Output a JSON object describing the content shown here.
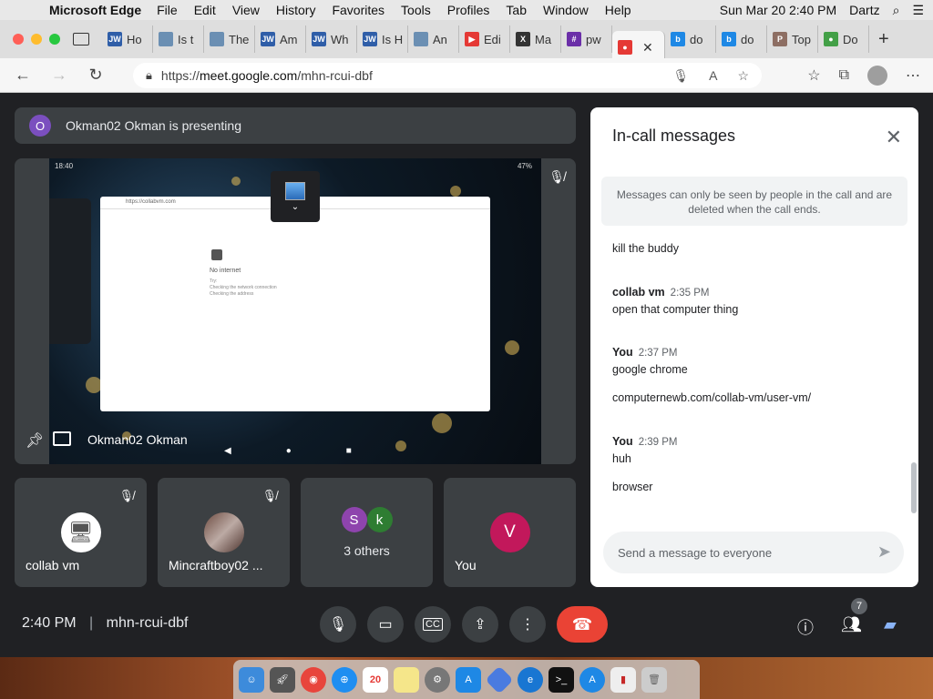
{
  "menubar": {
    "app_name": "Microsoft Edge",
    "items": [
      "File",
      "Edit",
      "View",
      "History",
      "Favorites",
      "Tools",
      "Profiles",
      "Tab",
      "Window",
      "Help"
    ],
    "datetime": "Sun Mar 20  2:40 PM",
    "user": "Dartz"
  },
  "tabs": [
    {
      "label": "Ho",
      "fav": "JW",
      "color": "#2f5ea8"
    },
    {
      "label": "Is t",
      "fav": "",
      "color": "#6b8fb3"
    },
    {
      "label": "The",
      "fav": "",
      "color": "#6b8fb3"
    },
    {
      "label": "Am",
      "fav": "JW",
      "color": "#2f5ea8"
    },
    {
      "label": "Wh",
      "fav": "JW",
      "color": "#2f5ea8"
    },
    {
      "label": "Is H",
      "fav": "JW",
      "color": "#2f5ea8"
    },
    {
      "label": "An",
      "fav": "",
      "color": "#6b8fb3"
    },
    {
      "label": "Edi",
      "fav": "▶",
      "color": "#e53935"
    },
    {
      "label": "Ma",
      "fav": "X",
      "color": "#333"
    },
    {
      "label": "pw",
      "fav": "#",
      "color": "#6b2fa8"
    },
    {
      "label": "",
      "fav": "●",
      "color": "#e53935",
      "active": true
    },
    {
      "label": "do",
      "fav": "b",
      "color": "#1e88e5"
    },
    {
      "label": "do",
      "fav": "b",
      "color": "#1e88e5"
    },
    {
      "label": "Top",
      "fav": "P",
      "color": "#8d6e63"
    },
    {
      "label": "Do",
      "fav": "●",
      "color": "#43a047"
    }
  ],
  "address": {
    "prefix": "https://",
    "host": "meet.google.com",
    "path": "/mhn-rcui-dbf"
  },
  "presenting": {
    "initial": "O",
    "text": "Okman02 Okman is presenting"
  },
  "stage": {
    "presenter_name": "Okman02 Okman",
    "phone_time": "18:40",
    "phone_battery": "47%",
    "browser_url": "https://collabvm.com",
    "no_internet": "No internet",
    "try_text": "Try:",
    "bullet1": "Checking the network connection",
    "bullet2": "Checking the address"
  },
  "tiles": [
    {
      "name": "collab vm"
    },
    {
      "name": "Mincraftboy02 ..."
    },
    {
      "name": "3 others",
      "initials": [
        "S",
        "k"
      ]
    },
    {
      "name": "You",
      "initial": "V"
    }
  ],
  "chat": {
    "title": "In-call messages",
    "notice": "Messages can only be seen by people in the call and are deleted when the call ends.",
    "messages": [
      {
        "sender": "",
        "time": "",
        "text": "kill the buddy"
      },
      {
        "sender": "collab vm",
        "time": "2:35 PM",
        "text": "open that computer thing"
      },
      {
        "sender": "You",
        "time": "2:37 PM",
        "text": "google chrome"
      },
      {
        "sender": "",
        "time": "",
        "text": "computernewb.com/collab-vm/user-vm/"
      },
      {
        "sender": "You",
        "time": "2:39 PM",
        "text": "huh"
      },
      {
        "sender": "",
        "time": "",
        "text": "browser"
      }
    ],
    "placeholder": "Send a message to everyone"
  },
  "bottom": {
    "time": "2:40 PM",
    "separator": "|",
    "meeting_code": "mhn-rcui-dbf",
    "participant_count": "7"
  },
  "dock": {
    "calendar_day": "20"
  }
}
